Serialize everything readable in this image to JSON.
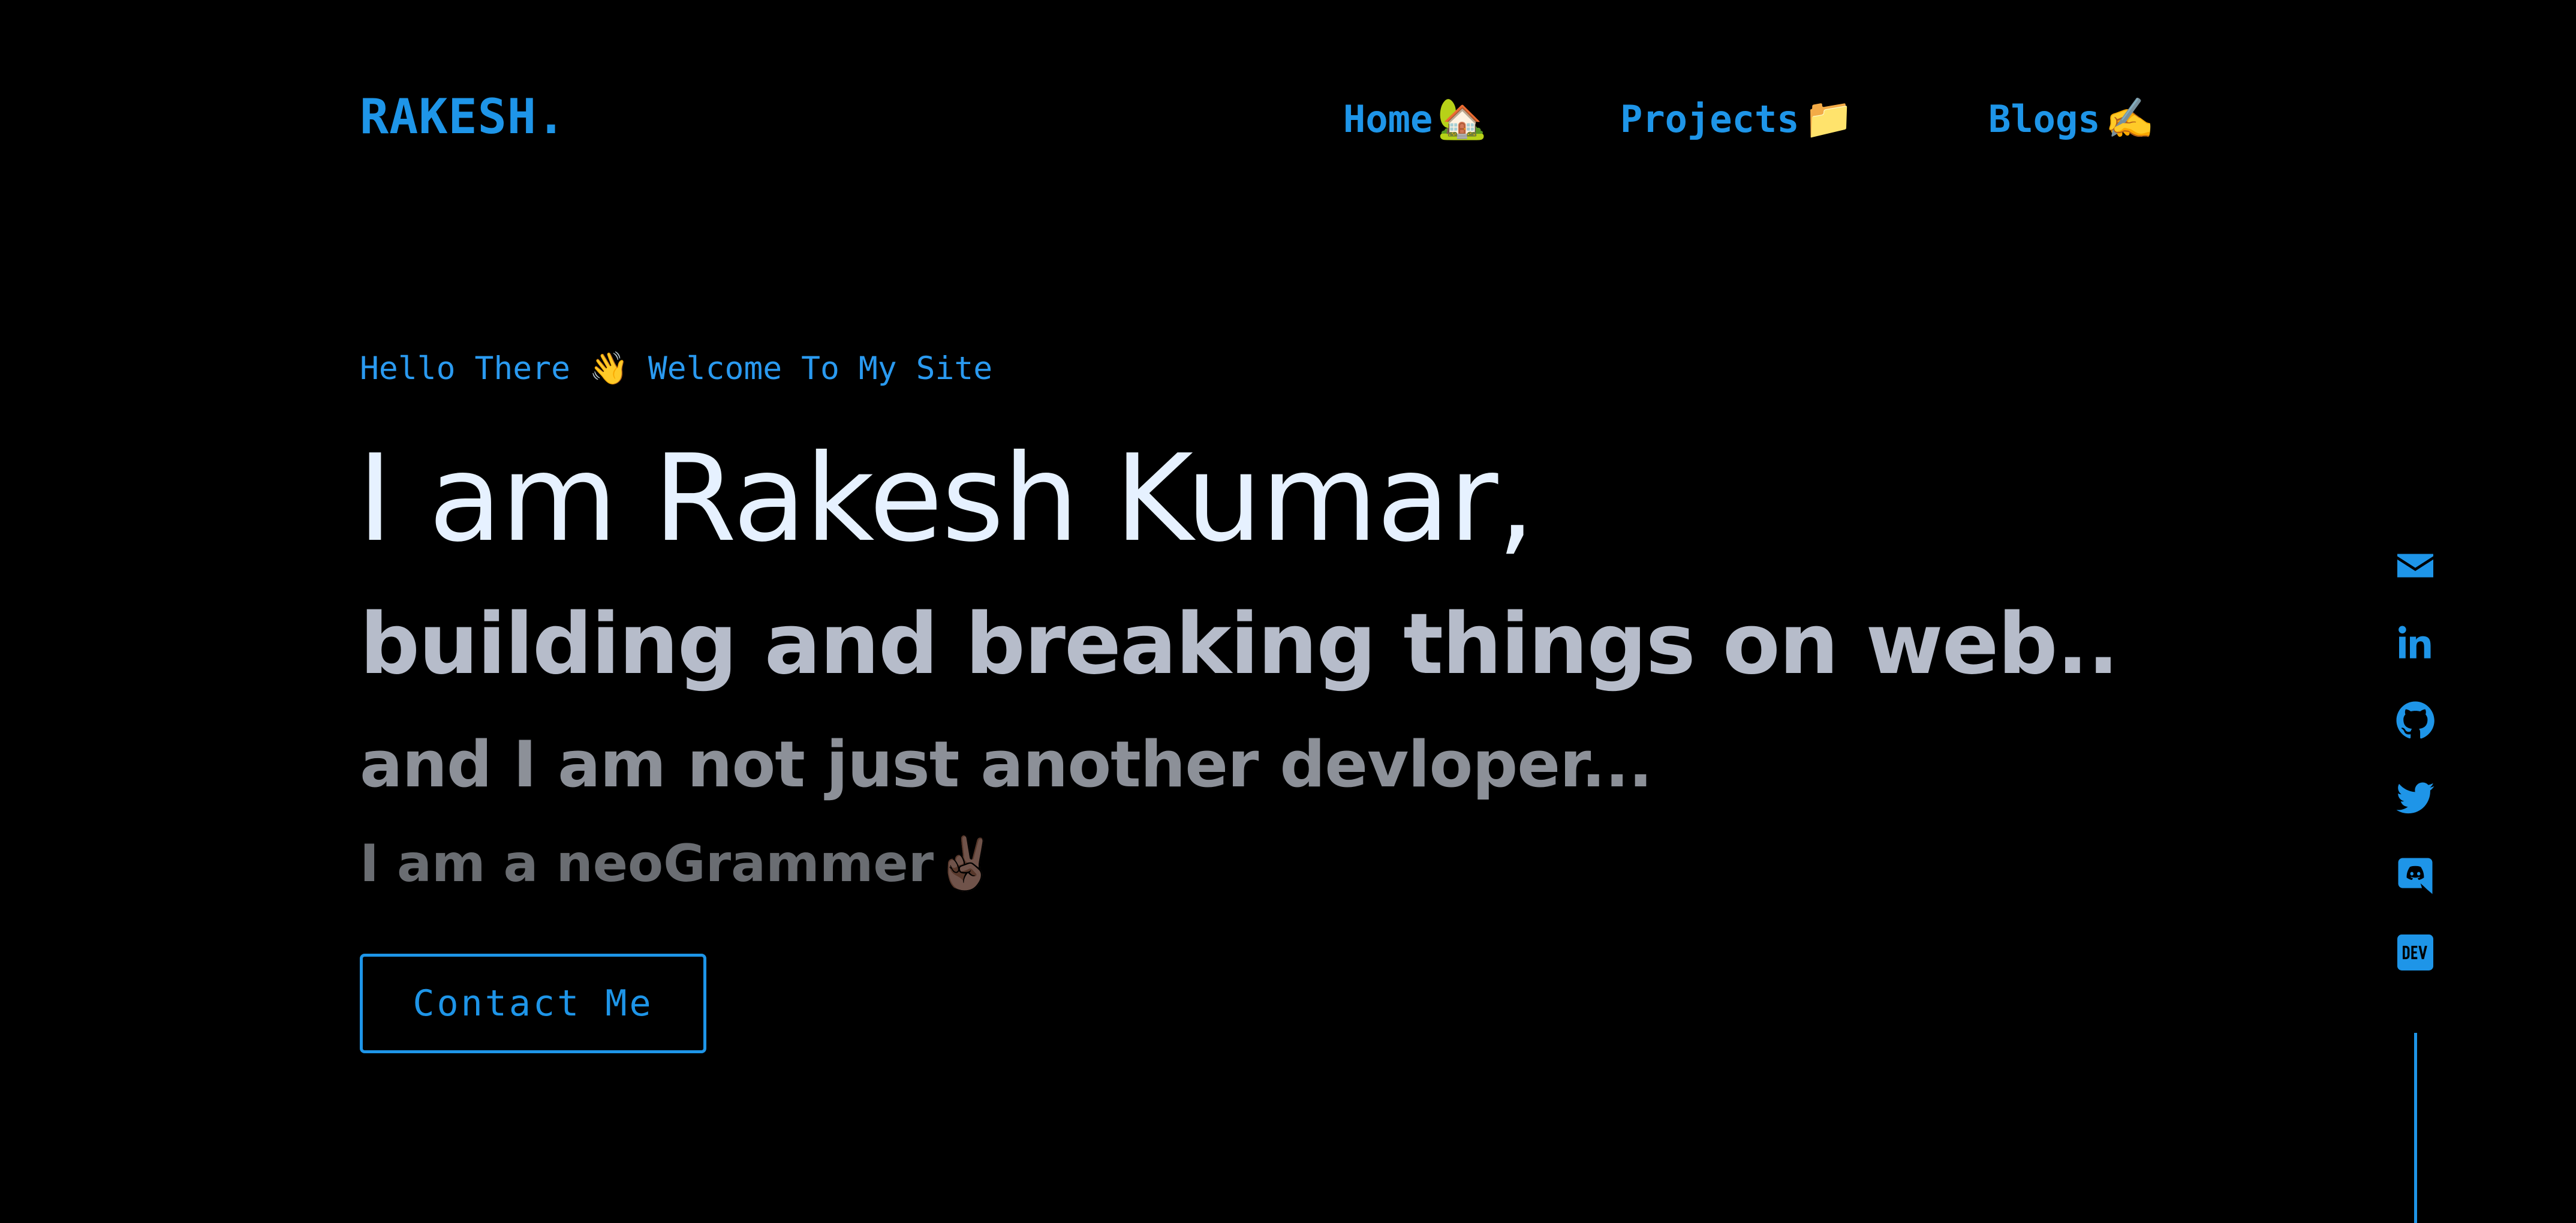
{
  "header": {
    "logo": "RAKESH.",
    "nav": [
      {
        "label": "Home",
        "emoji": "🏡"
      },
      {
        "label": "Projects",
        "emoji": "📁"
      },
      {
        "label": "Blogs",
        "emoji": "✍️"
      }
    ]
  },
  "hero": {
    "greeting_prefix": "Hello There",
    "greeting_emoji": "👋",
    "greeting_suffix": "Welcome To My Site",
    "headline": "I am Rakesh Kumar,",
    "tagline": "building and breaking things on web..",
    "subline": "and I am not just another devloper...",
    "identity": "I am a neoGrammer✌🏿",
    "contact_button": "Contact Me"
  },
  "social_links": [
    {
      "icon": "mail-icon"
    },
    {
      "icon": "linkedin-icon"
    },
    {
      "icon": "github-icon"
    },
    {
      "icon": "twitter-icon"
    },
    {
      "icon": "discord-icon"
    },
    {
      "icon": "dev-icon"
    }
  ],
  "colors": {
    "background": "#000000",
    "accent": "#1e95e8",
    "headline": "#e6f1ff",
    "tagline": "#b6bcca",
    "subline": "#8c9098",
    "identity": "#6a6d72"
  }
}
